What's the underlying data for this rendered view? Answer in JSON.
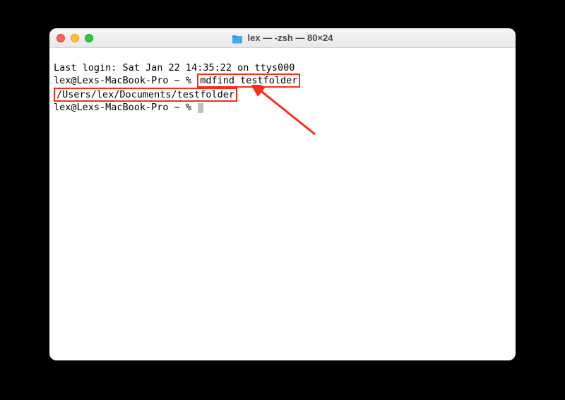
{
  "window": {
    "title": "lex — -zsh — 80×24"
  },
  "terminal": {
    "line1": "Last login: Sat Jan 22 14:35:22 on ttys000",
    "line2_prompt": "lex@Lexs-MacBook-Pro ~ % ",
    "line2_command": "mdfind testfolder",
    "line3_output": "/Users/lex/Documents/testfolder",
    "line4_prompt": "lex@Lexs-MacBook-Pro ~ % "
  },
  "annotation": {
    "highlight_color": "#ff2a1a",
    "arrow": "arrow pointing to output"
  }
}
